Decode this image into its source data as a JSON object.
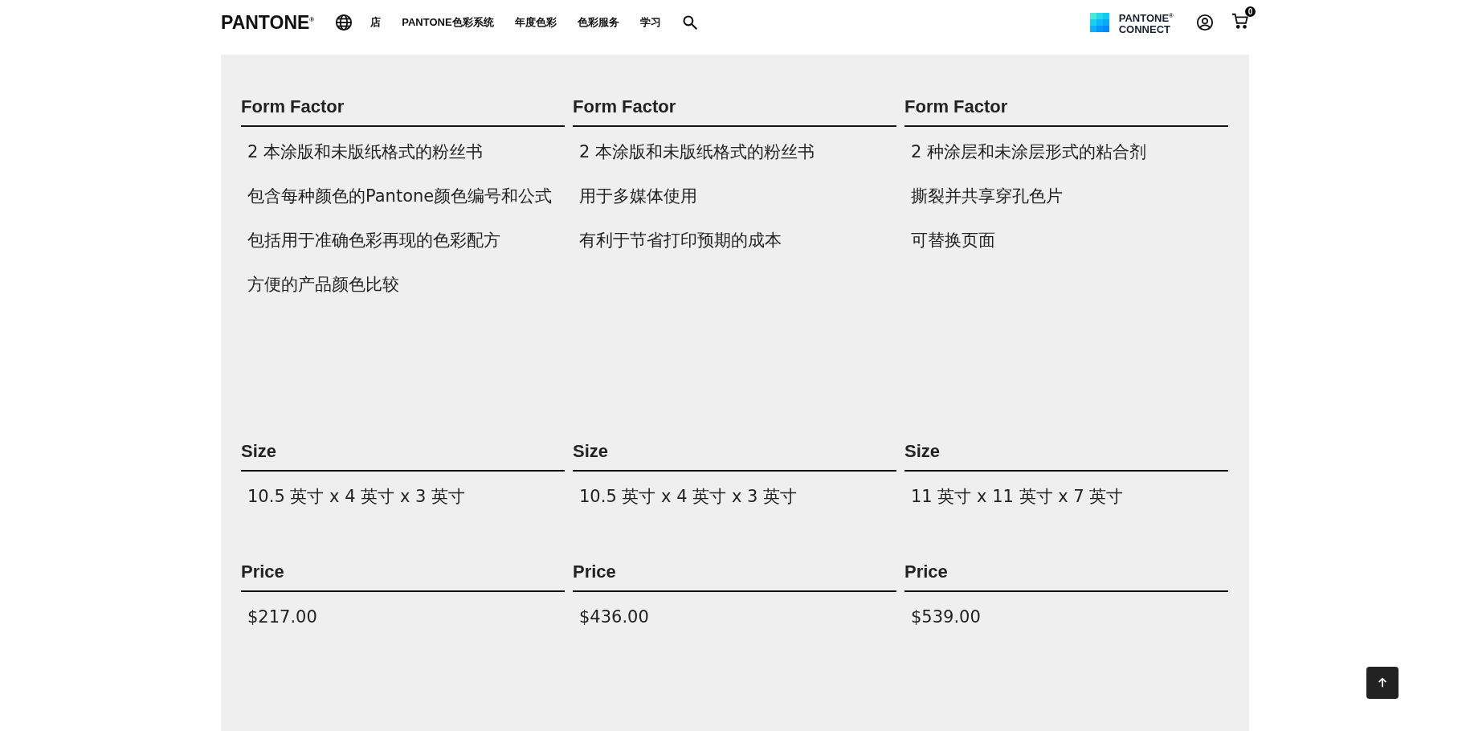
{
  "header": {
    "logo": "PANTONE$^{®}$",
    "nav": [
      "店",
      "PANTONE色彩系统",
      "年度色彩",
      "色彩服务",
      "学习"
    ],
    "connect": {
      "line1": "PANTONE$^{®}$",
      "line2": "CONNECT"
    },
    "cart_count": "0"
  },
  "spec_rows": [
    {
      "kind": "list",
      "cells": [
        {
          "heading": "Form Factor",
          "items": [
            "2 本涂版和未版纸格式的粉丝书",
            "包含每种颜色的Pantone颜色编号和公式",
            "包括用于准确色彩再现的色彩配方",
            "方便的产品颜色比较"
          ]
        },
        {
          "heading": "Form Factor",
          "items": [
            "2 本涂版和未版纸格式的粉丝书",
            "用于多媒体使用",
            "有利于节省打印预期的成本"
          ]
        },
        {
          "heading": "Form Factor",
          "items": [
            "2 种涂层和未涂层形式的粘合剂",
            "撕裂并共享穿孔色片",
            "可替换页面"
          ]
        }
      ]
    },
    {
      "kind": "value",
      "cells": [
        {
          "heading": "Size",
          "items": [
            "10.5 英寸 x 4 英寸 x 3 英寸"
          ]
        },
        {
          "heading": "Size",
          "items": [
            "10.5 英寸 x 4 英寸 x 3 英寸"
          ]
        },
        {
          "heading": "Size",
          "items": [
            "11 英寸 x 11 英寸 x 7 英寸"
          ]
        }
      ]
    },
    {
      "kind": "value",
      "cells": [
        {
          "heading": "Price",
          "items": [
            "$217.00"
          ]
        },
        {
          "heading": "Price",
          "items": [
            "$436.00"
          ]
        },
        {
          "heading": "Price",
          "items": [
            "$539.00"
          ]
        }
      ]
    }
  ]
}
